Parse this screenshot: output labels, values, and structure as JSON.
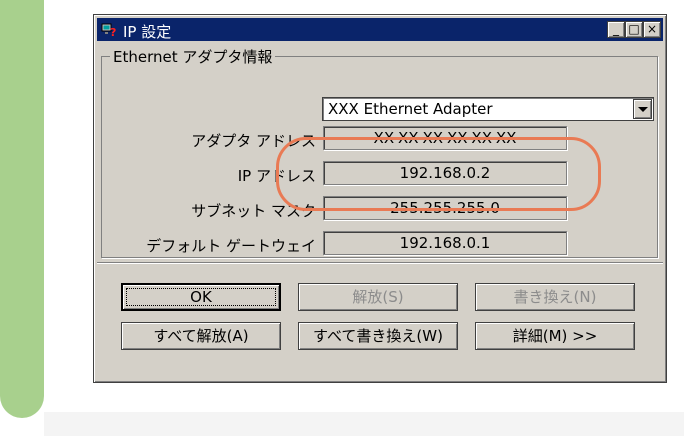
{
  "window": {
    "title": "IP 設定",
    "controls": {
      "minimize": "_",
      "maximize": "□",
      "close": "×"
    }
  },
  "group": {
    "legend": "Ethernet アダプタ情報"
  },
  "adapter_select": {
    "value": "XXX Ethernet Adapter"
  },
  "fields": [
    {
      "label": "アダプタ アドレス",
      "value": "XX-XX-XX-XX-XX-XX"
    },
    {
      "label": "IP アドレス",
      "value": "192.168.0.2"
    },
    {
      "label": "サブネット マスク",
      "value": "255.255.255.0"
    },
    {
      "label": "デフォルト ゲートウェイ",
      "value": "192.168.0.1"
    }
  ],
  "buttons": {
    "ok": "OK",
    "release": "解放(S)",
    "renew": "書き換え(N)",
    "release_all": "すべて解放(A)",
    "renew_all": "すべて書き換え(W)",
    "details": "詳細(M) >>"
  },
  "colors": {
    "titlebar": "#0a246a",
    "highlight_circle": "#e97a54",
    "side_bar": "#a8d08d",
    "dialog_face": "#d4d0c8"
  },
  "icons": {
    "app": "network-question-icon",
    "dropdown": "chevron-down-icon"
  }
}
